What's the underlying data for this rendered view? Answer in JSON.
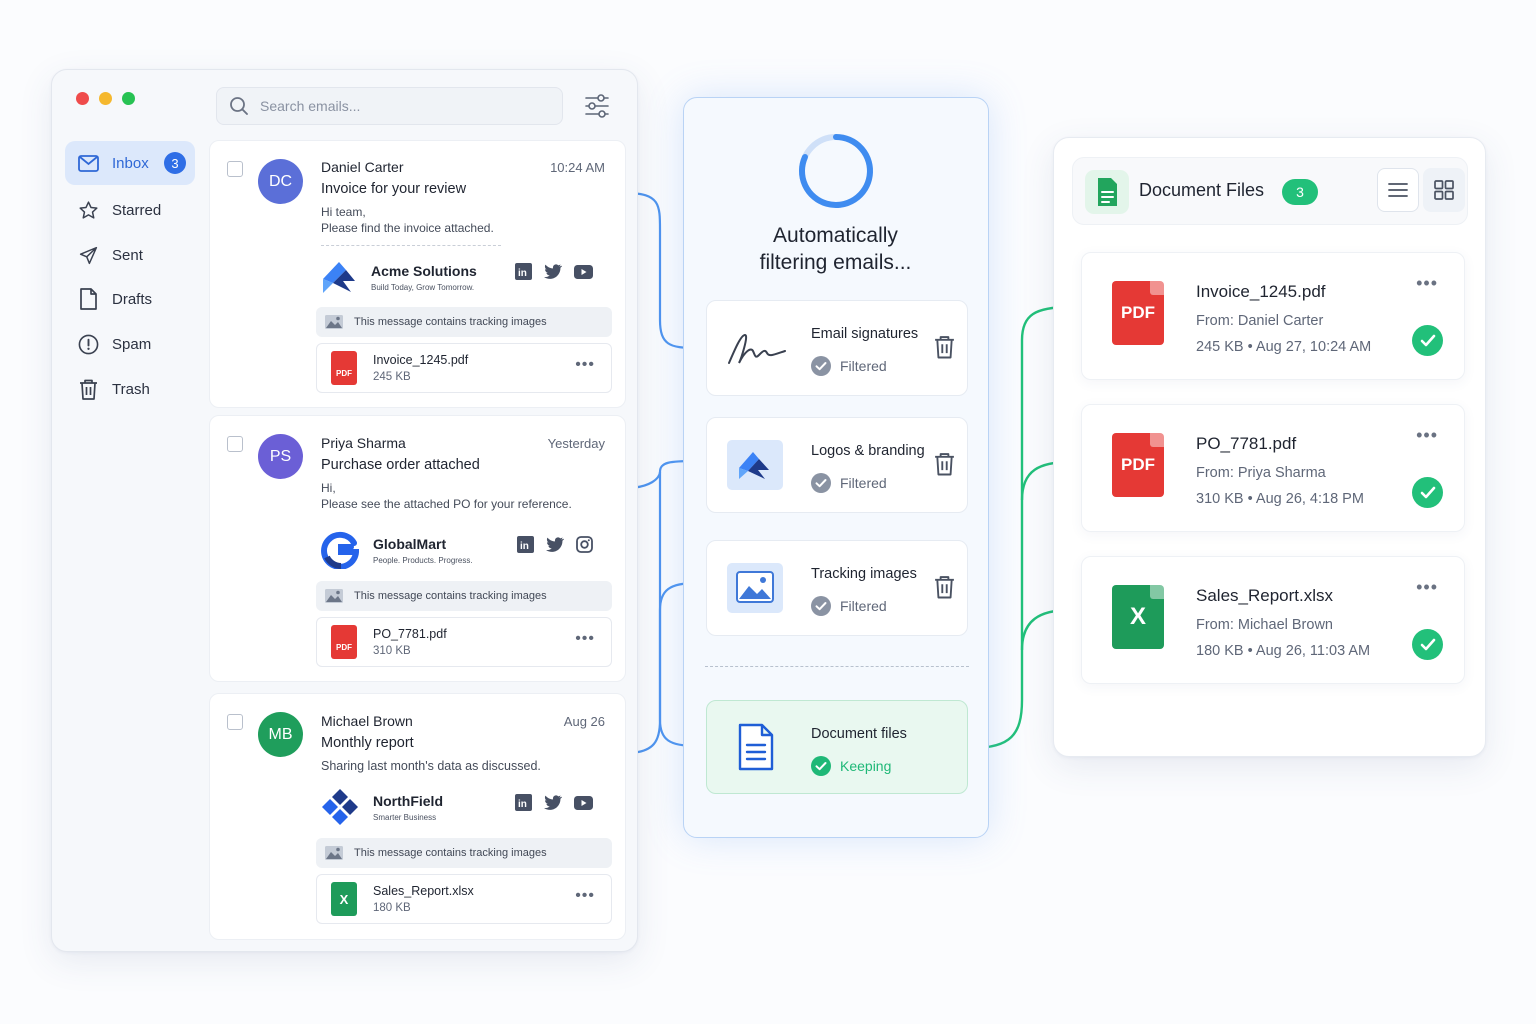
{
  "window": {
    "dots": [
      "#ef4b4b",
      "#f5b82e",
      "#27c253"
    ]
  },
  "sidebar": {
    "items": [
      {
        "label": "Inbox",
        "icon": "mail-icon",
        "count": "3",
        "active": true
      },
      {
        "label": "Starred",
        "icon": "star-icon"
      },
      {
        "label": "Sent",
        "icon": "send-icon"
      },
      {
        "label": "Drafts",
        "icon": "document-icon"
      },
      {
        "label": "Spam",
        "icon": "alert-icon"
      },
      {
        "label": "Trash",
        "icon": "trash-icon"
      }
    ]
  },
  "search": {
    "placeholder": "Search emails..."
  },
  "emails": [
    {
      "initials": "DC",
      "avatar_color": "#5b6fd8",
      "sender": "Daniel Carter",
      "time": "10:24 AM",
      "subject": "Invoice for your review",
      "body_line1": "Hi team,",
      "body_line2": "Please find the invoice attached.",
      "brand_name": "Acme Solutions",
      "brand_tagline": "Build Today, Grow Tomorrow.",
      "tracking": "This message contains tracking images",
      "attachment_name": "Invoice_1245.pdf",
      "attachment_size": "245 KB",
      "attachment_type": "PDF"
    },
    {
      "initials": "PS",
      "avatar_color": "#6b5fd6",
      "sender": "Priya Sharma",
      "time": "Yesterday",
      "subject": "Purchase order attached",
      "body_line1": "Hi,",
      "body_line2": "Please see the attached PO for your reference.",
      "brand_name": "GlobalMart",
      "brand_tagline": "People. Products. Progress.",
      "tracking": "This message contains tracking images",
      "attachment_name": "PO_7781.pdf",
      "attachment_size": "310 KB",
      "attachment_type": "PDF"
    },
    {
      "initials": "MB",
      "avatar_color": "#1f9e5c",
      "sender": "Michael Brown",
      "time": "Aug 26",
      "subject": "Monthly report",
      "body_line1": "Sharing last month's data as discussed.",
      "brand_name": "NorthField",
      "brand_tagline": "Smarter Business",
      "tracking": "This message contains tracking images",
      "attachment_name": "Sales_Report.xlsx",
      "attachment_size": "180 KB",
      "attachment_type": "X"
    }
  ],
  "filter": {
    "title_line1": "Automatically",
    "title_line2": "filtering emails...",
    "rules": [
      {
        "name": "Email signatures",
        "status": "Filtered",
        "icon": "signature-icon"
      },
      {
        "name": "Logos & branding",
        "status": "Filtered",
        "icon": "logo-icon"
      },
      {
        "name": "Tracking images",
        "status": "Filtered",
        "icon": "image-icon"
      }
    ],
    "keep": {
      "name": "Document files",
      "status": "Keeping",
      "icon": "document-icon"
    },
    "colors": {
      "filtered": "#8a93a3",
      "keeping": "#1fb877",
      "accent": "#3f8cf0"
    }
  },
  "documents": {
    "title": "Document Files",
    "count": "3",
    "files": [
      {
        "name": "Invoice_1245.pdf",
        "from": "From: Daniel Carter",
        "size": "245 KB",
        "date": "Aug 27, 10:24 AM",
        "type": "PDF"
      },
      {
        "name": "PO_7781.pdf",
        "from": "From: Priya Sharma",
        "size": "310 KB",
        "date": "Aug 26, 4:18 PM",
        "type": "PDF"
      },
      {
        "name": "Sales_Report.xlsx",
        "from": "From: Michael Brown",
        "size": "180 KB",
        "date": "Aug 26, 11:03 AM",
        "type": "X"
      }
    ]
  }
}
